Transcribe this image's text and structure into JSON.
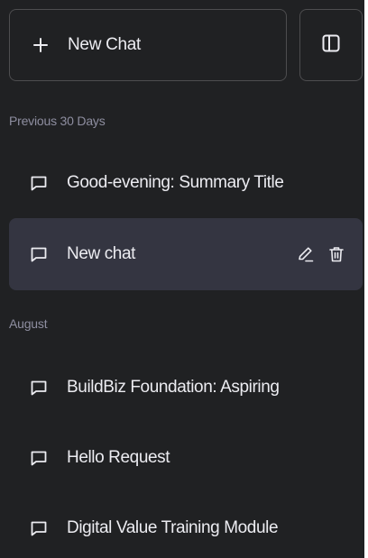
{
  "header": {
    "new_chat_label": "New Chat"
  },
  "sections": [
    {
      "title": "Previous 30 Days",
      "items": [
        {
          "title": "Good-evening: Summary Title",
          "active": false
        },
        {
          "title": "New chat",
          "active": true
        }
      ]
    },
    {
      "title": "August",
      "items": [
        {
          "title": "BuildBiz Foundation: Aspiring",
          "active": false
        },
        {
          "title": "Hello Request",
          "active": false
        },
        {
          "title": "Digital Value Training Module",
          "active": false
        }
      ]
    }
  ],
  "icons": {
    "new_chat": "plus-icon",
    "toggle": "sidebar-toggle-icon",
    "chat_item": "chat-bubble-icon",
    "edit": "pencil-icon",
    "delete": "trash-icon"
  },
  "colors": {
    "sidebar_bg": "#202123",
    "active_item_bg": "#343541",
    "text": "#ececf1",
    "section_text": "#8e8ea0",
    "border": "#4d4d4f"
  }
}
